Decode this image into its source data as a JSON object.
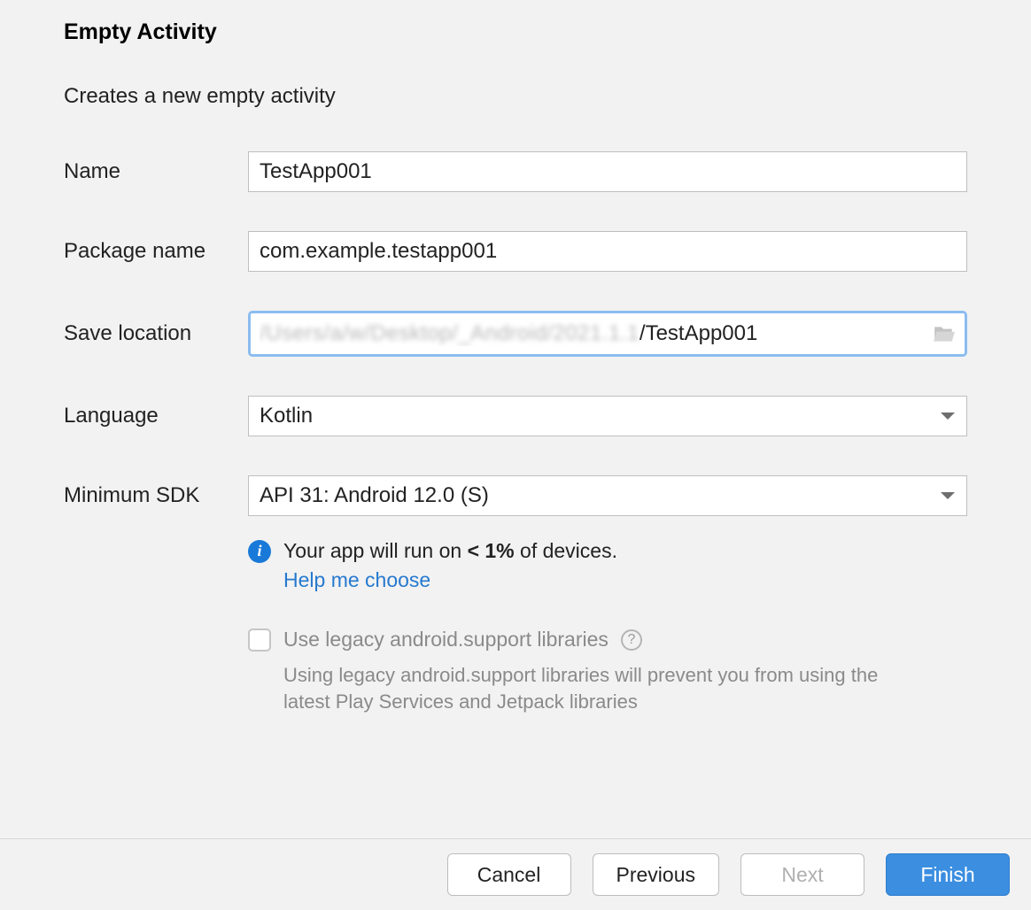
{
  "header": {
    "title": "Empty Activity",
    "subtitle": "Creates a new empty activity"
  },
  "form": {
    "name_label": "Name",
    "name_value": "TestApp001",
    "package_label": "Package name",
    "package_value": "com.example.testapp001",
    "save_label": "Save location",
    "save_blur": "/Users/a/w/Desktop/_Android/2021.1.1",
    "save_clear": "/TestApp001",
    "language_label": "Language",
    "language_value": "Kotlin",
    "sdk_label": "Minimum SDK",
    "sdk_value": "API 31: Android 12.0 (S)"
  },
  "info": {
    "prefix": "Your app will run on ",
    "percent": "< 1%",
    "suffix": " of devices.",
    "help_link": "Help me choose"
  },
  "legacy": {
    "checkbox_label": "Use legacy android.support libraries",
    "hint": "Using legacy android.support libraries will prevent you from using the latest Play Services and Jetpack libraries"
  },
  "buttons": {
    "cancel": "Cancel",
    "previous": "Previous",
    "next": "Next",
    "finish": "Finish"
  }
}
